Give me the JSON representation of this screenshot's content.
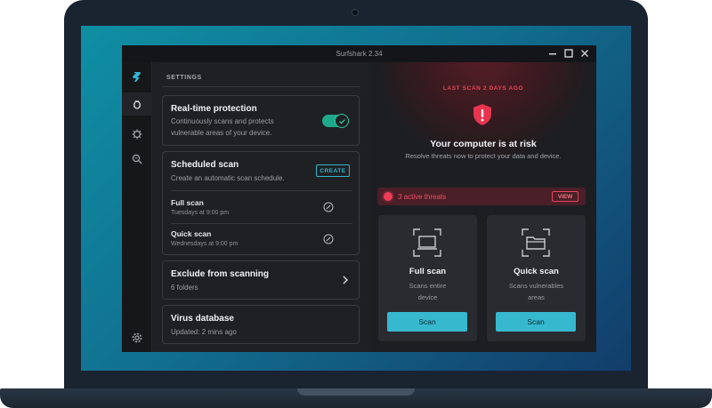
{
  "window": {
    "title": "Surfshark 2.34"
  },
  "settings": {
    "header": "SETTINGS",
    "realtime": {
      "title": "Real-time protection",
      "desc_line1": "Continuously scans and protects",
      "desc_line2": "vulnerable areas of your device.",
      "enabled": true
    },
    "scheduled": {
      "title": "Scheduled scan",
      "desc": "Create an automatic scan schedule.",
      "create_label": "CREATE",
      "rows": [
        {
          "name": "Full scan",
          "time": "Tuesdays at 9:00 pm"
        },
        {
          "name": "Quick scan",
          "time": "Wednesdays at 9:00 pm"
        }
      ]
    },
    "exclude": {
      "title": "Exclude from scanning",
      "desc": "6 folders"
    },
    "database": {
      "title": "Virus database",
      "desc": "Updated: 2 mins ago"
    }
  },
  "status": {
    "last_scan": "LAST SCAN 2 DAYS AGO",
    "title": "Your computer is at risk",
    "subtitle": "Resolve threats now to protect your data and device."
  },
  "threats": {
    "text": "3 active threats",
    "view_label": "VIEW"
  },
  "scans": [
    {
      "title": "Full scan",
      "desc_line1": "Scans entire",
      "desc_line2": "device",
      "button": "Scan"
    },
    {
      "title": "Quick scan",
      "desc_line1": "Scans vulnerables",
      "desc_line2": "areas",
      "button": "Scan"
    }
  ],
  "colors": {
    "accent": "#36b8cf",
    "danger": "#e8445e",
    "toggle_on": "#1fa88a",
    "window_bg": "#1d1e22"
  },
  "icons": {
    "sidebar": [
      "surfshark-logo-icon",
      "antivirus-bug-icon",
      "virus-icon",
      "search-icon",
      "settings-gear-icon"
    ]
  }
}
